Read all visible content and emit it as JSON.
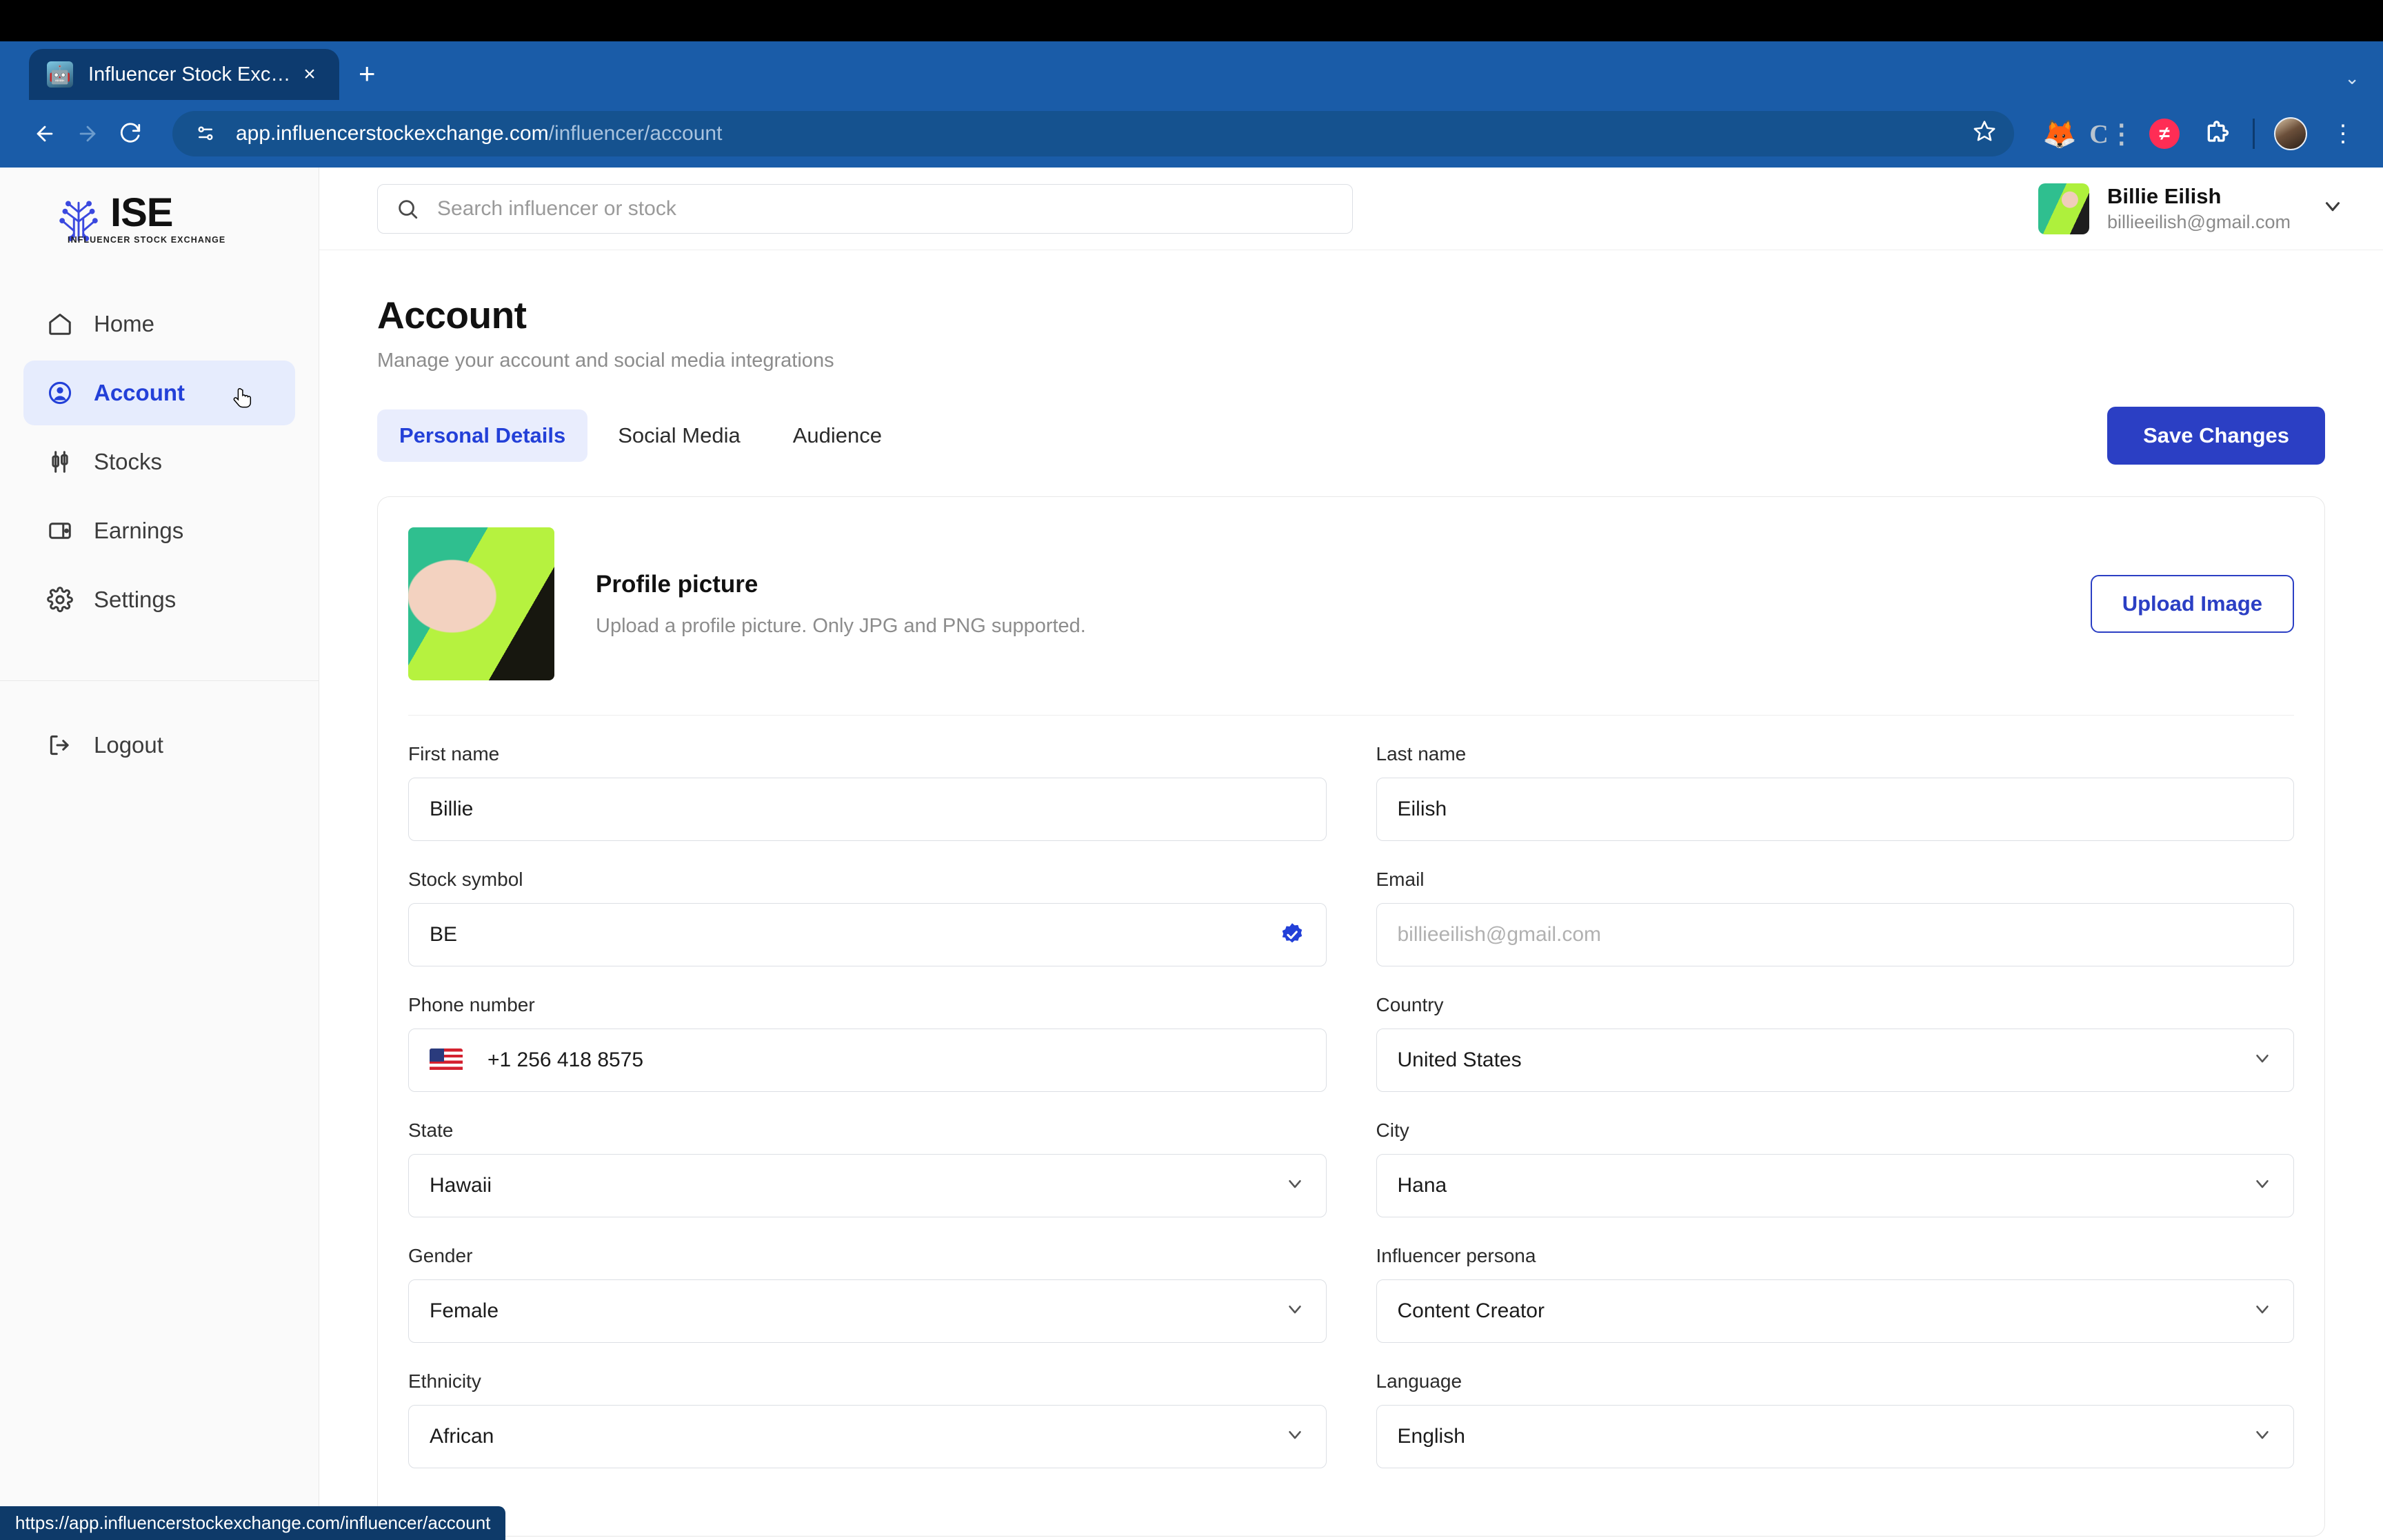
{
  "browser": {
    "tab": {
      "title": "Influencer Stock Exchange",
      "favicon": "robot-icon",
      "close_label": "×"
    },
    "new_tab_label": "+",
    "tabstrip_expand_label": "⌄",
    "omnibox": {
      "site_icon": "page-info-icon",
      "url_host": "app.influencerstockexchange.com",
      "url_path": "/influencer/account",
      "star_icon": "bookmark-star-icon"
    },
    "extensions": [
      {
        "name": "metamask-extension-icon",
        "glyph": "🦊"
      },
      {
        "name": "colon-c-extension-icon",
        "glyph": "C"
      },
      {
        "name": "pink-extension-icon",
        "glyph": "≠"
      },
      {
        "name": "extensions-puzzle-icon",
        "glyph": "puzzle"
      },
      {
        "name": "profile-avatar-icon",
        "glyph": ""
      },
      {
        "name": "chrome-menu-icon",
        "glyph": "⋮"
      }
    ],
    "status_bar_url": "https://app.influencerstockexchange.com/influencer/account"
  },
  "sidebar": {
    "logo": {
      "text": "ISE",
      "subtitle": "INFLUENCER STOCK EXCHANGE"
    },
    "items": [
      {
        "label": "Home",
        "icon": "home-icon",
        "active": false
      },
      {
        "label": "Account",
        "icon": "user-circle-icon",
        "active": true
      },
      {
        "label": "Stocks",
        "icon": "candlestick-icon",
        "active": false
      },
      {
        "label": "Earnings",
        "icon": "wallet-icon",
        "active": false
      },
      {
        "label": "Settings",
        "icon": "gear-icon",
        "active": false
      }
    ],
    "logout": {
      "label": "Logout",
      "icon": "logout-icon"
    }
  },
  "topbar": {
    "search": {
      "placeholder": "Search influencer or stock",
      "value": "",
      "icon": "search-icon"
    },
    "user": {
      "name": "Billie Eilish",
      "email": "billieeilish@gmail.com",
      "avatar": "user-avatar",
      "caret": "chevron-down-icon"
    }
  },
  "page": {
    "title": "Account",
    "subtitle": "Manage your account and social media integrations",
    "tabs": [
      {
        "label": "Personal Details",
        "active": true
      },
      {
        "label": "Social Media",
        "active": false
      },
      {
        "label": "Audience",
        "active": false
      }
    ],
    "save_button": "Save Changes"
  },
  "profile_picture": {
    "title": "Profile picture",
    "description": "Upload a profile picture. Only JPG and PNG supported.",
    "upload_button": "Upload Image"
  },
  "form": {
    "first_name": {
      "label": "First name",
      "value": "Billie",
      "type": "text"
    },
    "last_name": {
      "label": "Last name",
      "value": "Eilish",
      "type": "text"
    },
    "stock_symbol": {
      "label": "Stock symbol",
      "value": "BE",
      "type": "text",
      "badge": "verified-badge-icon"
    },
    "email": {
      "label": "Email",
      "value": "",
      "placeholder": "billieeilish@gmail.com",
      "type": "text"
    },
    "phone": {
      "label": "Phone number",
      "value": "+1 256 418 8575",
      "type": "tel",
      "flag": "us-flag-icon"
    },
    "country": {
      "label": "Country",
      "value": "United States",
      "type": "select"
    },
    "state": {
      "label": "State",
      "value": "Hawaii",
      "type": "select"
    },
    "city": {
      "label": "City",
      "value": "Hana",
      "type": "select"
    },
    "gender": {
      "label": "Gender",
      "value": "Female",
      "type": "select"
    },
    "persona": {
      "label": "Influencer persona",
      "value": "Content Creator",
      "type": "select"
    },
    "ethnicity": {
      "label": "Ethnicity",
      "value": "African",
      "type": "select"
    },
    "language": {
      "label": "Language",
      "value": "English",
      "type": "select"
    }
  },
  "colors": {
    "accent": "#2b3fc4",
    "accent_soft": "#e6ecfd",
    "browser_chrome": "#1a5ca8",
    "tab_active": "#0d3b6f"
  }
}
